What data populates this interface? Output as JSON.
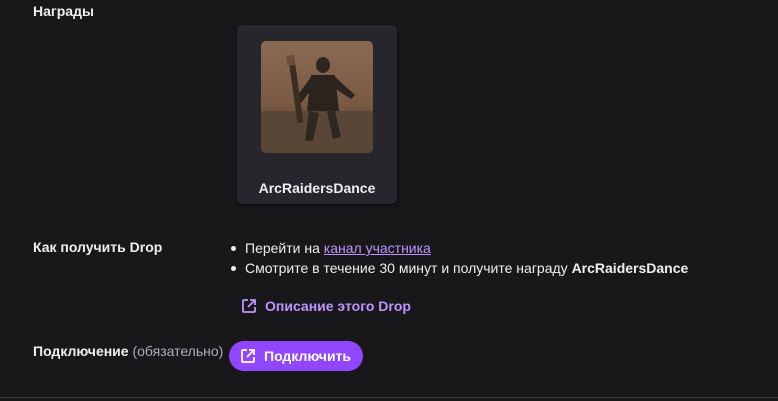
{
  "rewards_section": {
    "title": "Награды",
    "reward": {
      "name": "ArcRaidersDance",
      "image_description_icon": "dance-emote-image"
    }
  },
  "how_to": {
    "label": "Как получить Drop",
    "step1_prefix": "Перейти на ",
    "step1_link": "канал участника",
    "step2_prefix": "Смотрите в течение 30 минут и получите награду ",
    "step2_reward": "ArcRaidersDance",
    "description_link": "Описание этого Drop"
  },
  "connection": {
    "label": "Подключение",
    "note": "(обязательно)",
    "button_label": "Подключить"
  },
  "colors": {
    "background": "#18181b",
    "card": "#26262c",
    "accent": "#9147ff",
    "link": "#bf94ff"
  }
}
